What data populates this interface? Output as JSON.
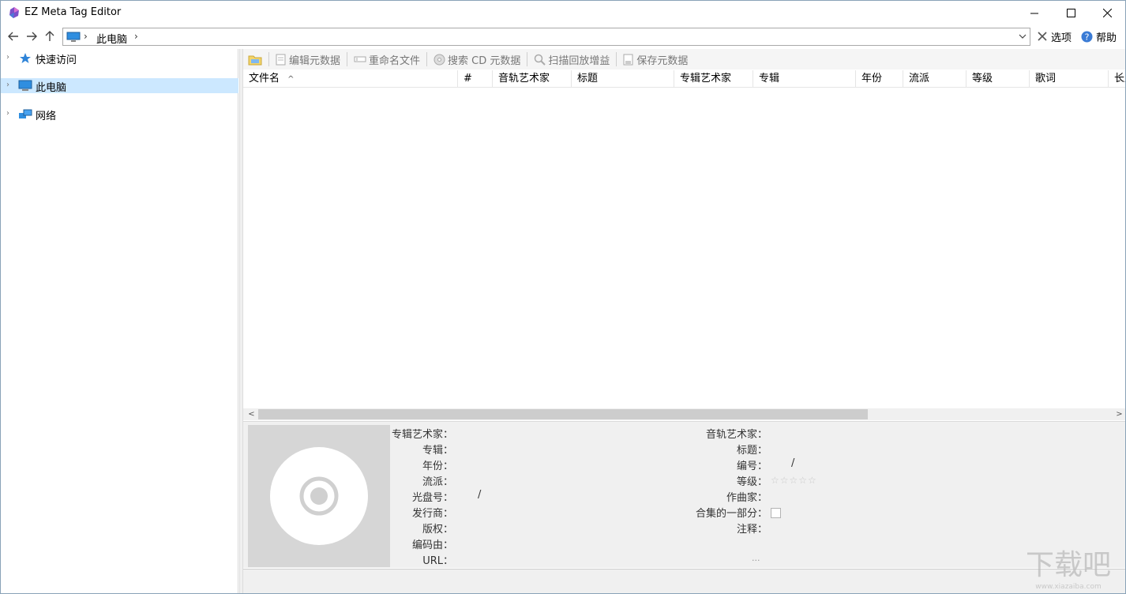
{
  "window": {
    "title": "EZ Meta Tag Editor",
    "controls": {
      "minimize": "minimize",
      "maximize": "maximize",
      "close": "close"
    }
  },
  "navigation": {
    "back": "back-arrow-icon",
    "forward": "forward-arrow-icon",
    "up": "up-arrow-icon",
    "address_crumb": "此电脑"
  },
  "menu": {
    "options_label": "选项",
    "help_label": "帮助"
  },
  "tree": {
    "items": [
      {
        "label": "快速访问",
        "icon": "star-icon",
        "selected": false
      },
      {
        "label": "此电脑",
        "icon": "computer-icon",
        "selected": true
      },
      {
        "label": "网络",
        "icon": "network-icon",
        "selected": false
      }
    ]
  },
  "toolbar": {
    "edit_label": "编辑元数据",
    "rename_label": "重命名文件",
    "search_cd_label": "搜索 CD 元数据",
    "scan_gain_label": "扫描回放增益",
    "save_label": "保存元数据"
  },
  "columns": [
    {
      "label": "文件名",
      "sort": "ascending"
    },
    {
      "label": "#"
    },
    {
      "label": "音轨艺术家"
    },
    {
      "label": "标题"
    },
    {
      "label": "专辑艺术家"
    },
    {
      "label": "专辑"
    },
    {
      "label": "年份"
    },
    {
      "label": "流派"
    },
    {
      "label": "等级"
    },
    {
      "label": "歌词"
    },
    {
      "label": "长度"
    }
  ],
  "details": {
    "left_fields": {
      "album_artist": "专辑艺术家：",
      "album": "专辑：",
      "year": "年份：",
      "genre": "流派：",
      "disc_number": "光盘号：",
      "disc_number_value": "/",
      "publisher": "发行商：",
      "copyright": "版权：",
      "encoded_by": "编码由：",
      "url": "URL："
    },
    "right_fields": {
      "track_artist": "音轨艺术家：",
      "title": "标题：",
      "track_number": "编号：",
      "track_number_value": "/",
      "rating": "等级：",
      "rating_stars": "☆☆☆☆☆",
      "composer": "作曲家：",
      "compilation": "合集的一部分：",
      "comment": "注释：",
      "comment_more": "..."
    }
  },
  "watermark": {
    "text": "下载吧",
    "url_text": "www.xiazaiba.com"
  },
  "colors": {
    "selection": "#cce8ff",
    "toolbar_bg": "#f5f5f5",
    "panel_bg": "#f0f0f0"
  }
}
